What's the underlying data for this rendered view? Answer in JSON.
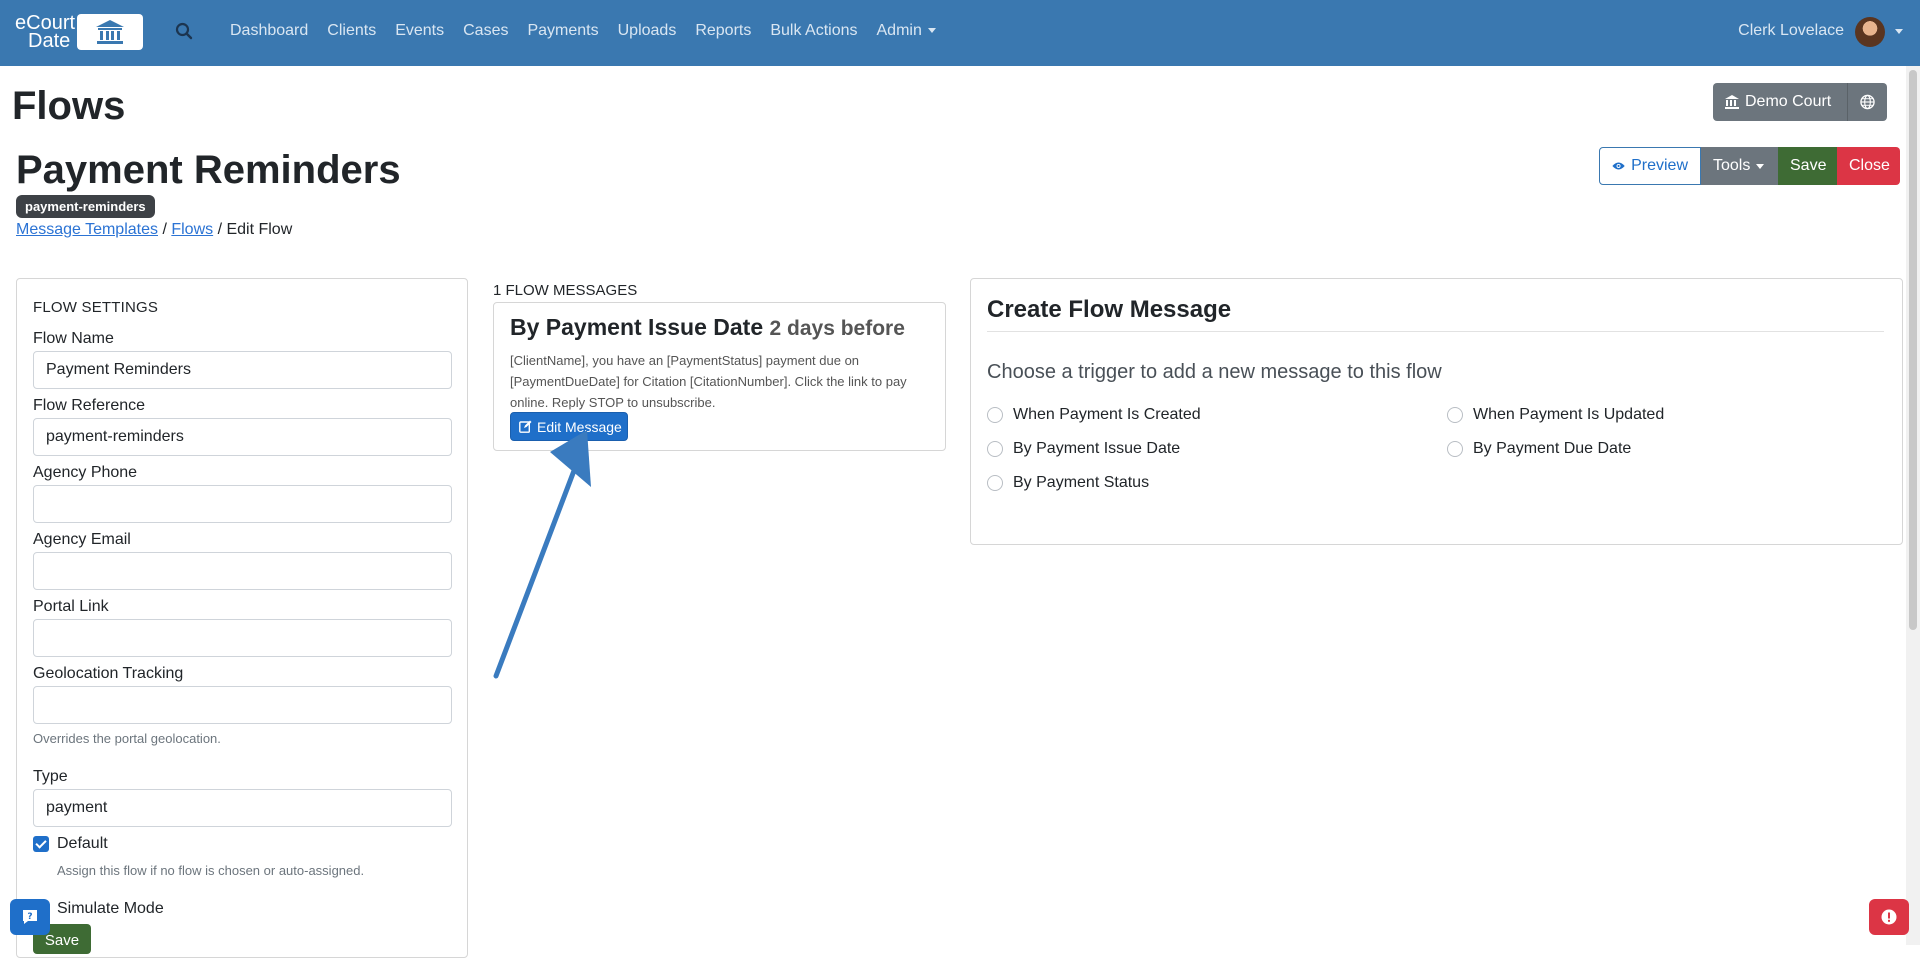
{
  "nav": {
    "logo_line1": "eCourt",
    "logo_line2": "Date",
    "links": [
      "Dashboard",
      "Clients",
      "Events",
      "Cases",
      "Payments",
      "Uploads",
      "Reports",
      "Bulk Actions",
      "Admin"
    ],
    "user_name": "Clerk Lovelace"
  },
  "page": {
    "title": "Flows",
    "court_button": "Demo Court"
  },
  "flow": {
    "title": "Payment Reminders",
    "badge": "payment-reminders",
    "breadcrumb": {
      "templates": "Message Templates",
      "sep1": " / ",
      "flows": "Flows",
      "current": " / Edit Flow"
    }
  },
  "actions": {
    "preview": "Preview",
    "tools": "Tools",
    "save": "Save",
    "close": "Close"
  },
  "settings": {
    "heading": "FLOW SETTINGS",
    "flow_name_label": "Flow Name",
    "flow_name_value": "Payment Reminders",
    "flow_ref_label": "Flow Reference",
    "flow_ref_value": "payment-reminders",
    "agency_phone_label": "Agency Phone",
    "agency_email_label": "Agency Email",
    "portal_link_label": "Portal Link",
    "geo_label": "Geolocation Tracking",
    "geo_hint": "Overrides the portal geolocation.",
    "type_label": "Type",
    "type_value": "payment",
    "default_label": "Default",
    "default_checked": true,
    "default_hint": "Assign this flow if no flow is chosen or auto-assigned.",
    "simulate_label": "Simulate Mode",
    "save_label": "Save"
  },
  "messages": {
    "heading": "1 FLOW MESSAGES",
    "items": [
      {
        "title": "By Payment Issue Date",
        "timing": "2 days before",
        "body": "[ClientName], you have an [PaymentStatus] payment due on [PaymentDueDate] for Citation [CitationNumber]. Click the link to pay online. Reply STOP to unsubscribe.",
        "edit_label": "Edit Message"
      }
    ]
  },
  "create": {
    "title": "Create Flow Message",
    "subtitle": "Choose a trigger to add a new message to this flow",
    "triggers": [
      "When Payment Is Created",
      "When Payment Is Updated",
      "By Payment Issue Date",
      "By Payment Due Date",
      "By Payment Status"
    ]
  },
  "colors": {
    "navbar": "#3a78b0",
    "primary": "#1f6fc9",
    "success": "#3e6b34",
    "danger": "#dc3545",
    "secondary": "#6c757d"
  }
}
